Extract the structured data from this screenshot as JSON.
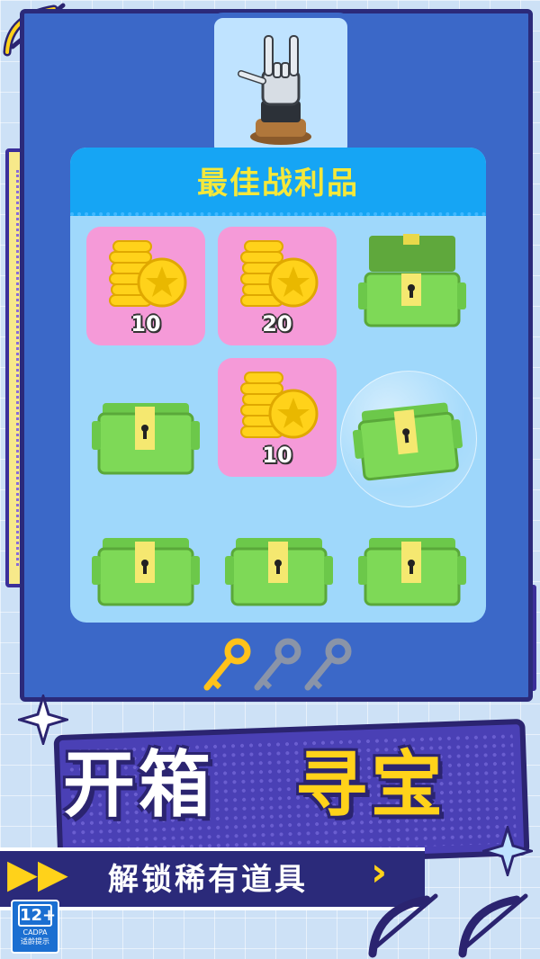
{
  "board": {
    "title": "最佳战利品"
  },
  "rewards": [
    {
      "value": "10"
    },
    {
      "value": "20"
    },
    {
      "value": "10"
    }
  ],
  "keys": {
    "collected": 1,
    "total": 3
  },
  "banner": {
    "title_part1": "开箱",
    "title_part2": "寻宝",
    "subtitle": "解锁稀有道具"
  },
  "age_rating": {
    "label": "12+",
    "org": "CADPA",
    "note": "适龄提示"
  },
  "colors": {
    "accent_yellow": "#ffd21a",
    "panel_blue": "#3b68c8",
    "board_header": "#16a5f4",
    "pink_cell": "#f59ad8",
    "chest_green": "#7ed957"
  },
  "icons": [
    "bow-arrow-icon",
    "robot-hand-trophy-icon",
    "gold-coin-stack-icon",
    "treasure-chest-icon",
    "key-icon",
    "sparkle-icon"
  ]
}
